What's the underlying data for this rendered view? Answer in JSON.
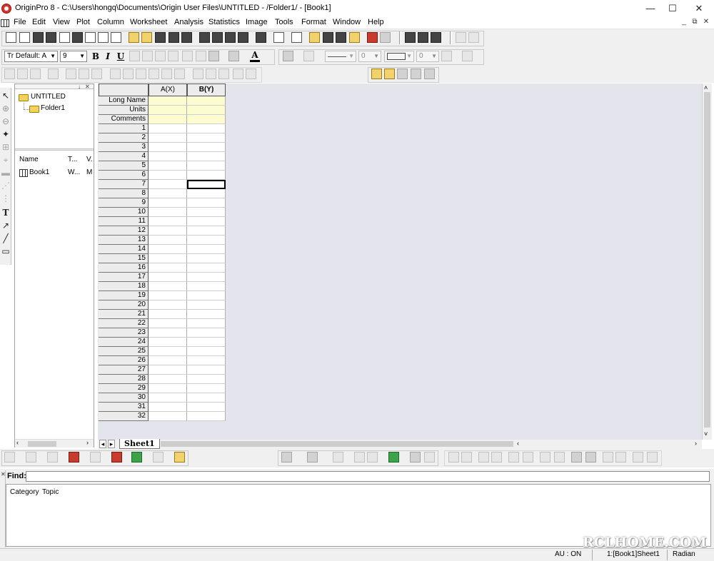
{
  "window": {
    "title": "OriginPro 8 - C:\\Users\\hongq\\Documents\\Origin User Files\\UNTITLED - /Folder1/ - [Book1]",
    "minimize": "—",
    "maximize": "☐",
    "close": "✕"
  },
  "menu": [
    "File",
    "Edit",
    "View",
    "Plot",
    "Column",
    "Worksheet",
    "Analysis",
    "Statistics",
    "Image",
    "Tools",
    "Format",
    "Window",
    "Help"
  ],
  "mdi_controls": [
    "_",
    "⧉",
    "✕"
  ],
  "format_toolbar": {
    "font_name": "Tr Default: A",
    "font_size": "9",
    "line_width": "0",
    "border_width": "0",
    "bold": "B",
    "italic": "I",
    "underline": "U",
    "font_color": "A"
  },
  "explorer": {
    "project": "UNTITLED",
    "folder": "Folder1",
    "columns": [
      "Name",
      "T...",
      "V."
    ],
    "items": [
      {
        "name": "Book1",
        "type": "W...",
        "view": "M"
      }
    ]
  },
  "worksheet": {
    "columns": [
      "A(X)",
      "B(Y)"
    ],
    "meta_rows": [
      "Long Name",
      "Units",
      "Comments"
    ],
    "row_count": 32,
    "selected_row": 7,
    "selected_col": 2,
    "sheet_tab": "Sheet1"
  },
  "find": {
    "label": "Find:",
    "value": "",
    "tabs": [
      "Category",
      "Topic"
    ]
  },
  "status": {
    "au": "AU : ON",
    "book": "1:[Book1]Sheet1",
    "angle": "Radian"
  },
  "watermark": "RCLHOME.COM"
}
